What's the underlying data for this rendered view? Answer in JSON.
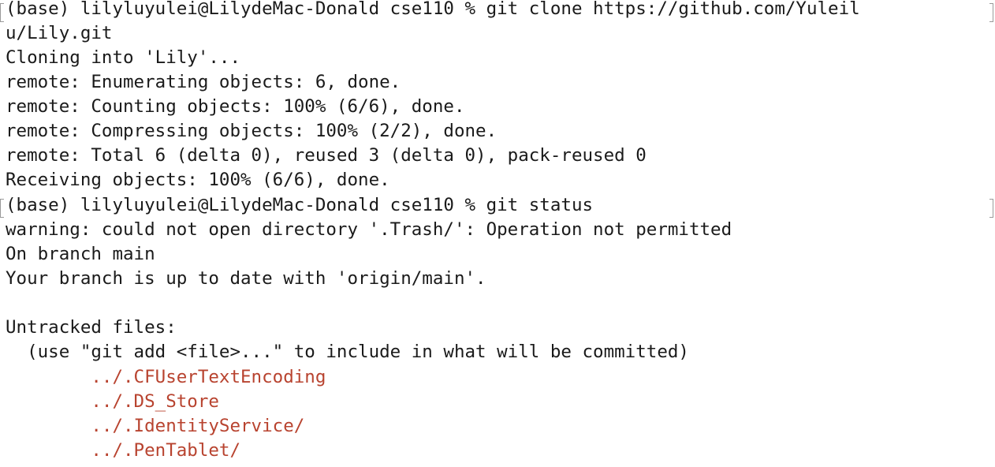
{
  "terminal": {
    "lines": [
      "(base) lilyluyulei@LilydeMac-Donald cse110 % git clone https://github.com/Yuleil",
      "u/Lily.git",
      "Cloning into 'Lily'...",
      "remote: Enumerating objects: 6, done.",
      "remote: Counting objects: 100% (6/6), done.",
      "remote: Compressing objects: 100% (2/2), done.",
      "remote: Total 6 (delta 0), reused 3 (delta 0), pack-reused 0",
      "Receiving objects: 100% (6/6), done.",
      "(base) lilyluyulei@LilydeMac-Donald cse110 % git status",
      "warning: could not open directory '.Trash/': Operation not permitted",
      "On branch main",
      "Your branch is up to date with 'origin/main'.",
      "",
      "Untracked files:",
      "  (use \"git add <file>...\" to include in what will be committed)",
      "        ../.CFUserTextEncoding",
      "        ../.DS_Store",
      "        ../.IdentityService/",
      "        ../.PenTablet/"
    ]
  },
  "colors": {
    "text": "#1a1a1a",
    "untracked": "#b8432f",
    "background": "#ffffff"
  }
}
